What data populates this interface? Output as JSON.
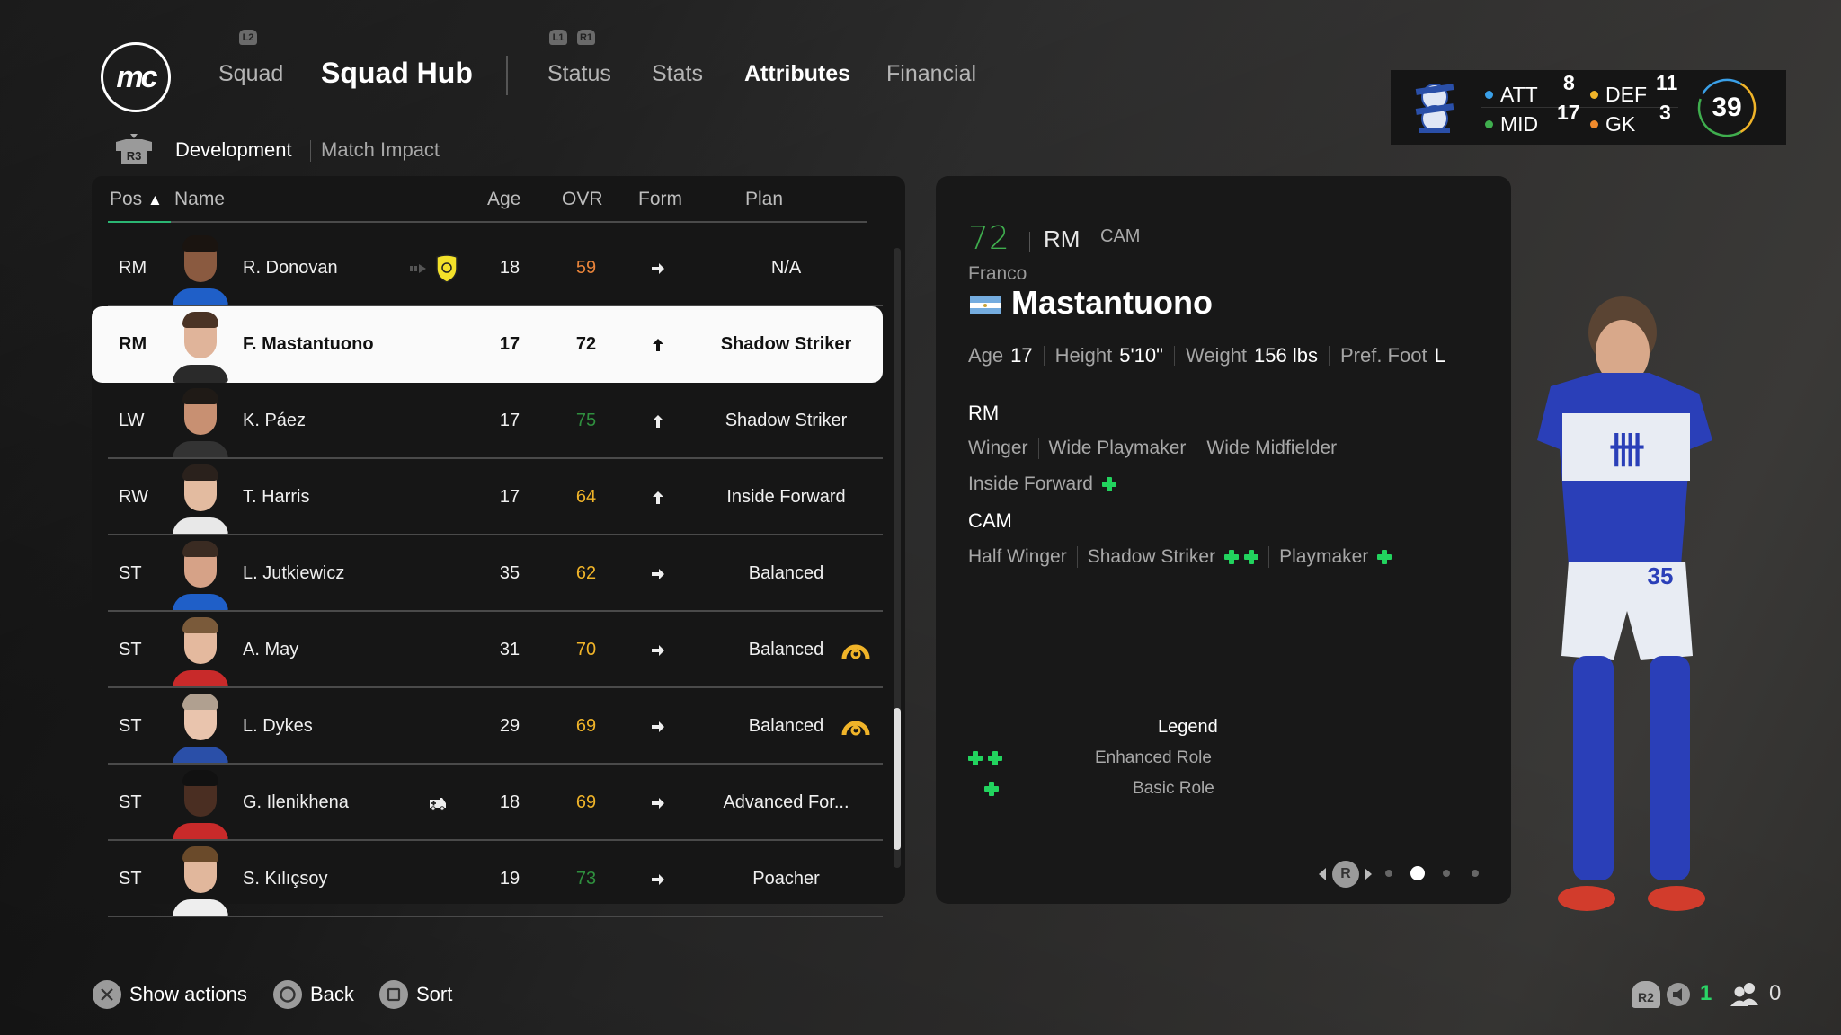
{
  "nav": {
    "logo_text": "mc",
    "l2_hint": "L2",
    "squad_label": "Squad",
    "title": "Squad Hub",
    "l1_hint": "L1",
    "r1_hint": "R1",
    "tabs": [
      {
        "label": "Status",
        "active": false
      },
      {
        "label": "Stats",
        "active": false
      },
      {
        "label": "Attributes",
        "active": true
      },
      {
        "label": "Financial",
        "active": false
      }
    ],
    "r3_hint": "R3",
    "subtabs": [
      {
        "label": "Development",
        "active": true
      },
      {
        "label": "Match Impact",
        "active": false
      }
    ]
  },
  "team_summary": {
    "att_label": "ATT",
    "att_value": "8",
    "att_color": "#3aa0e8",
    "def_label": "DEF",
    "def_value": "11",
    "def_color": "#f0b429",
    "mid_label": "MID",
    "mid_value": "17",
    "mid_color": "#3fae4e",
    "gk_label": "GK",
    "gk_value": "3",
    "gk_color": "#f08a2c",
    "total": "39"
  },
  "table": {
    "headers": {
      "pos": "Pos",
      "sort_indicator": "▲",
      "name": "Name",
      "age": "Age",
      "ovr": "OVR",
      "form": "Form",
      "plan": "Plan"
    },
    "rows": [
      {
        "pos": "RM",
        "name": "R. Donovan",
        "age": "18",
        "ovr": "59",
        "ovr_color": "#e8833a",
        "form": "steady",
        "plan": "N/A",
        "status_icon": "loan-club-badge",
        "selected": false
      },
      {
        "pos": "RM",
        "name": "F. Mastantuono",
        "age": "17",
        "ovr": "72",
        "ovr_color": "#111111",
        "form": "up",
        "plan": "Shadow Striker",
        "status_icon": "",
        "selected": true
      },
      {
        "pos": "LW",
        "name": "K. Páez",
        "age": "17",
        "ovr": "75",
        "ovr_color": "#2f8f3e",
        "form": "up",
        "plan": "Shadow Striker",
        "status_icon": "",
        "selected": false
      },
      {
        "pos": "RW",
        "name": "T. Harris",
        "age": "17",
        "ovr": "64",
        "ovr_color": "#f0b429",
        "form": "up",
        "plan": "Inside Forward",
        "status_icon": "",
        "selected": false
      },
      {
        "pos": "ST",
        "name": "L. Jutkiewicz",
        "age": "35",
        "ovr": "62",
        "ovr_color": "#f0b429",
        "form": "steady",
        "plan": "Balanced",
        "status_icon": "",
        "selected": false
      },
      {
        "pos": "ST",
        "name": "A. May",
        "age": "31",
        "ovr": "70",
        "ovr_color": "#f0b429",
        "form": "steady",
        "plan": "Balanced",
        "status_icon": "sharpness-gauge",
        "selected": false
      },
      {
        "pos": "ST",
        "name": "L. Dykes",
        "age": "29",
        "ovr": "69",
        "ovr_color": "#f0b429",
        "form": "steady",
        "plan": "Balanced",
        "status_icon": "sharpness-gauge",
        "selected": false
      },
      {
        "pos": "ST",
        "name": "G. Ilenikhena",
        "age": "18",
        "ovr": "69",
        "ovr_color": "#f0b429",
        "form": "steady",
        "plan": "Advanced For...",
        "status_icon": "injury-ambulance",
        "selected": false
      },
      {
        "pos": "ST",
        "name": "S. Kılıçsoy",
        "age": "19",
        "ovr": "73",
        "ovr_color": "#2f8f3e",
        "form": "steady",
        "plan": "Poacher",
        "status_icon": "",
        "selected": false
      }
    ]
  },
  "detail": {
    "ovr": "72",
    "ovr_color": "#3fae4e",
    "primary_pos": "RM",
    "secondary_pos": "CAM",
    "first_name": "Franco",
    "last_name": "Mastantuono",
    "nationality_flag": "argentina-flag",
    "bio": {
      "age_label": "Age",
      "age": "17",
      "height_label": "Height",
      "height": "5'10\"",
      "weight_label": "Weight",
      "weight": "156 lbs",
      "foot_label": "Pref. Foot",
      "foot": "L"
    },
    "role_groups": [
      {
        "position": "RM",
        "roles": [
          {
            "name": "Winger",
            "level": 0
          },
          {
            "name": "Wide Playmaker",
            "level": 0
          },
          {
            "name": "Wide Midfielder",
            "level": 0
          },
          {
            "name": "Inside Forward",
            "level": 1
          }
        ]
      },
      {
        "position": "CAM",
        "roles": [
          {
            "name": "Half Winger",
            "level": 0
          },
          {
            "name": "Shadow Striker",
            "level": 2
          },
          {
            "name": "Playmaker",
            "level": 1
          }
        ]
      }
    ],
    "legend": {
      "title": "Legend",
      "enhanced": "Enhanced Role",
      "basic": "Basic Role"
    },
    "pager": {
      "hint": "R",
      "pages": 4,
      "current": 2
    },
    "shirt_number": "35"
  },
  "footer": {
    "actions": [
      {
        "icon": "cross-button-icon",
        "label": "Show actions"
      },
      {
        "icon": "circle-button-icon",
        "label": "Back"
      },
      {
        "icon": "square-button-icon",
        "label": "Sort"
      }
    ],
    "r2_hint": "R2",
    "notifications_count": "1",
    "notifications_color": "#2bd366",
    "social_count": "0"
  }
}
